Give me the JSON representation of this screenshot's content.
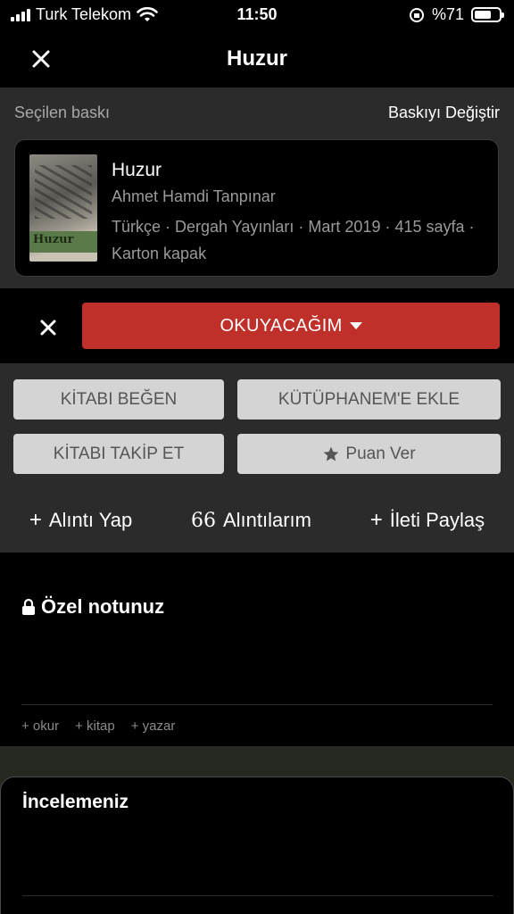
{
  "status_bar": {
    "carrier": "Turk Telekom",
    "time": "11:50",
    "battery": "%71",
    "battery_level": 0.71
  },
  "nav": {
    "title": "Huzur",
    "close_icon": "close-icon"
  },
  "edition": {
    "label": "Seçilen baskı",
    "change_link": "Baskıyı Değiştir",
    "book": {
      "cover_text": "Huzur",
      "title": "Huzur",
      "author": "Ahmet Hamdi Tanpınar",
      "meta": "Türkçe · Dergah Yayınları · Mart 2019 · 415 sayfa · Karton kapak"
    }
  },
  "reading_status": {
    "label": "OKUYACAĞIM",
    "color": "#c0302a"
  },
  "actions": {
    "like": "KİTABI BEĞEN",
    "add_library": "KÜTÜPHANEM'E EKLE",
    "follow": "KİTABI TAKİP ET",
    "rate": "Puan Ver"
  },
  "links": {
    "quote": "Alıntı Yap",
    "my_quotes": "Alıntılarım",
    "share_post": "İleti Paylaş"
  },
  "notes": {
    "title": "Özel notunuz",
    "tags": [
      "+ okur",
      "+ kitap",
      "+ yazar"
    ]
  },
  "review": {
    "title": "İncelemeniz"
  }
}
